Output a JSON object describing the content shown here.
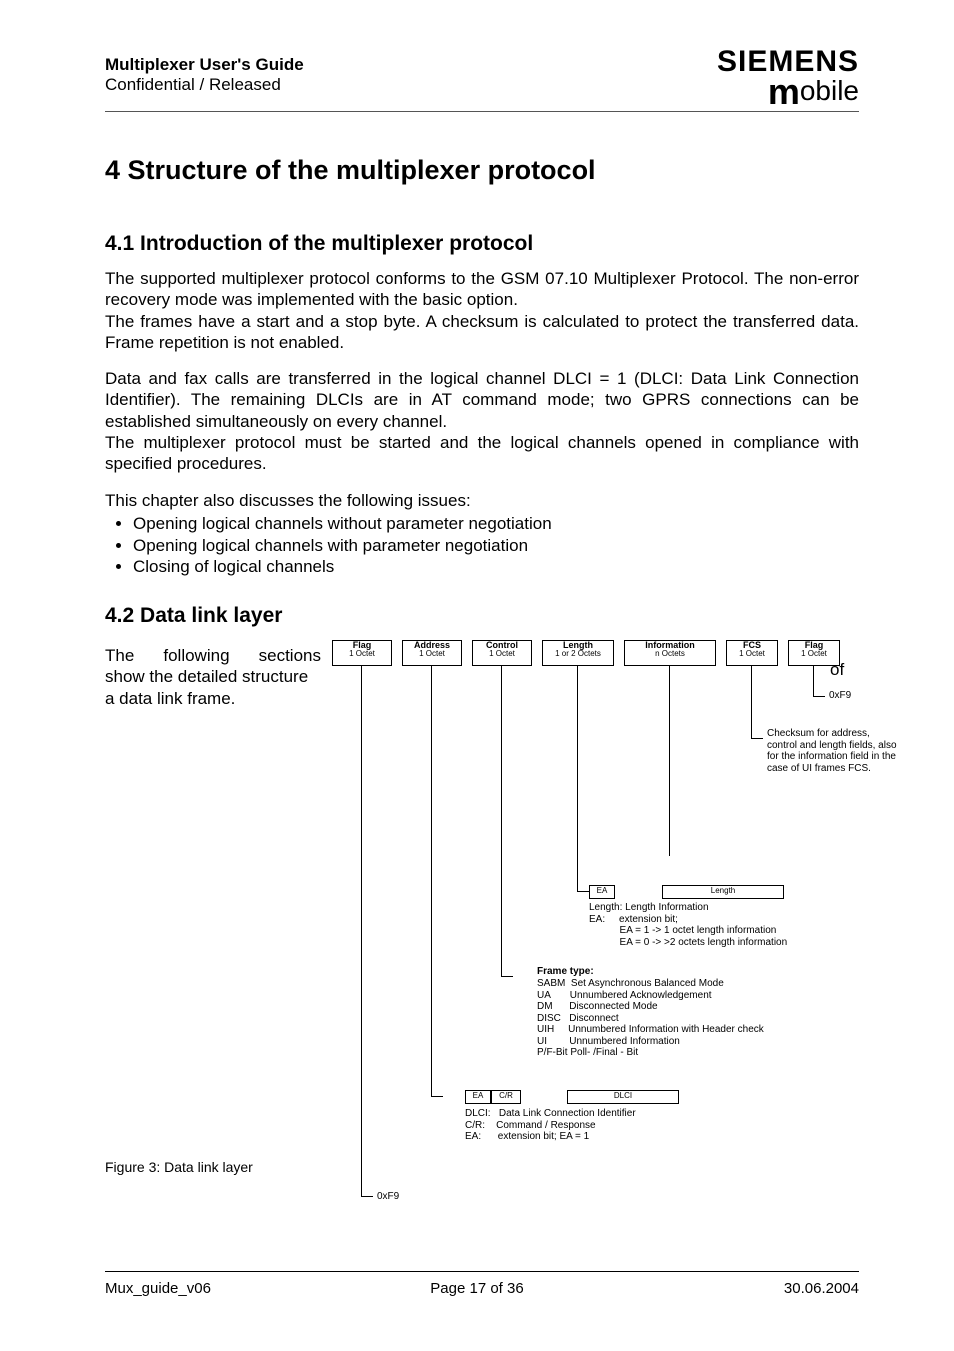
{
  "header": {
    "title": "Multiplexer User's Guide",
    "subtitle": "Confidential / Released",
    "brand_top": "SIEMENS",
    "brand_bottom_m": "m",
    "brand_bottom_rest": "obile"
  },
  "h1": "4  Structure of the multiplexer protocol",
  "s41": {
    "heading": "4.1  Introduction of the multiplexer protocol",
    "p1": "The supported multiplexer protocol conforms to the GSM 07.10 Multiplexer Protocol. The non-error recovery mode was implemented with the basic option.\nThe frames have a start and a stop byte. A checksum is calculated to protect the transferred data. Frame repetition is not enabled.",
    "p2": "Data and fax calls are transferred in the logical channel DLCI = 1 (DLCI: Data Link Connection Identifier). The remaining DLCIs are in AT command mode; two GPRS connections can be established simultaneously on every channel.\nThe multiplexer protocol must be started and the logical channels opened in compliance with specified procedures.",
    "p3_lead": "This chapter also discusses the following issues:",
    "bullets": [
      "Opening logical channels without parameter negotiation",
      "Opening logical channels with parameter negotiation",
      "Closing of logical channels"
    ]
  },
  "s42": {
    "heading": "4.2  Data link layer",
    "intro_l1_w1": "The",
    "intro_l1_w2": "following",
    "intro_l1_w3": "sections",
    "intro_l2": "show the detailed structure",
    "intro_of": "of",
    "intro_l3": "a data link frame.",
    "figcap": "Figure 3: Data link layer"
  },
  "diagram": {
    "boxes": [
      {
        "t1": "Flag",
        "t2": "1 Octet"
      },
      {
        "t1": "Address",
        "t2": "1 Octet"
      },
      {
        "t1": "Control",
        "t2": "1 Octet"
      },
      {
        "t1": "Length",
        "t2": "1 or 2 Octets"
      },
      {
        "t1": "Information",
        "t2": "n Octets"
      },
      {
        "t1": "FCS",
        "t2": "1 Octet"
      },
      {
        "t1": "Flag",
        "t2": "1 Octet"
      }
    ],
    "flag_right": "0xF9",
    "fcs_note": "Checksum for address, control and length fields, also for the information field in the case of UI frames FCS.",
    "length_sub": {
      "ea": "EA",
      "len": "Length"
    },
    "length_note": "Length: Length Information\nEA:     extension bit;\n           EA = 1 -> 1 octet length information\n           EA = 0 -> >2 octets length information",
    "frame_title": "Frame type:",
    "frame_lines": "SABM  Set Asynchronous Balanced Mode\nUA       Unnumbered Acknowledgement\nDM      Disconnected Mode\nDISC   Disconnect\nUIH     Unnumbered Information with Header check\nUI        Unnumbered Information\nP/F-Bit Poll- /Final - Bit",
    "addr_sub": {
      "ea": "EA",
      "cr": "C/R",
      "dlci": "DLCI"
    },
    "addr_note": "DLCI:   Data Link Connection Identifier\nC/R:    Command / Response\nEA:      extension bit; EA = 1",
    "flag_left": "0xF9"
  },
  "footer": {
    "left": "Mux_guide_v06",
    "center": "Page 17 of 36",
    "right": "30.06.2004"
  }
}
